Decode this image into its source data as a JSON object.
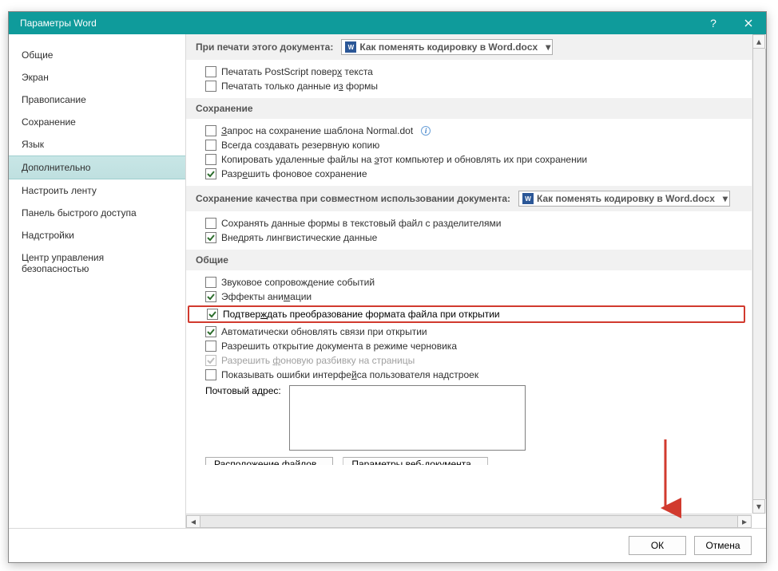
{
  "window": {
    "title": "Параметры Word",
    "help": "?",
    "close": "✕"
  },
  "sidebar": {
    "items": [
      {
        "label": "Общие"
      },
      {
        "label": "Экран"
      },
      {
        "label": "Правописание"
      },
      {
        "label": "Сохранение"
      },
      {
        "label": "Язык"
      },
      {
        "label": "Дополнительно",
        "selected": true
      },
      {
        "label": "Настроить ленту"
      },
      {
        "label": "Панель быстрого доступа"
      },
      {
        "label": "Надстройки"
      },
      {
        "label": "Центр управления безопасностью"
      }
    ]
  },
  "print": {
    "header": "При печати этого документа:",
    "doc": "Как поменять кодировку в Word.docx",
    "opt1": {
      "checked": false,
      "label_pre": "Печатать PostScript повер",
      "acc": "х",
      "label_post": " текста"
    },
    "opt2": {
      "checked": false,
      "label_pre": "Печатать только данные и",
      "acc": "з",
      "label_post": " формы"
    }
  },
  "save": {
    "header": "Сохранение",
    "opt1": {
      "checked": false,
      "label_pre": "",
      "acc": "З",
      "label_post": "апрос на сохранение шаблона Normal.dot"
    },
    "opt2": {
      "checked": false,
      "label": "Всегда создавать резервную копию"
    },
    "opt3": {
      "checked": false,
      "label_pre": "Копировать удаленные файлы на ",
      "acc": "э",
      "label_post": "тот компьютер и обновлять их при сохранении"
    },
    "opt4": {
      "checked": true,
      "label_pre": "Разр",
      "acc": "е",
      "label_post": "шить фоновое сохранение"
    }
  },
  "fidelity": {
    "header": "Сохранение качества при совместном использовании документа:",
    "doc": "Как поменять кодировку в Word.docx",
    "opt1": {
      "checked": false,
      "label": "Сохранять данные формы в текстовый файл с разделителями"
    },
    "opt2": {
      "checked": true,
      "label": "Внедрять лингвистические данные"
    }
  },
  "general": {
    "header": "Общие",
    "opt1": {
      "checked": false,
      "label": "Звуковое сопровождение событий"
    },
    "opt2": {
      "checked": true,
      "label_pre": "Эффекты ани",
      "acc": "м",
      "label_post": "ации"
    },
    "opt3": {
      "checked": true,
      "label_pre": "Подтвер",
      "acc": "ж",
      "label_post": "дать преобразование формата файла при открытии"
    },
    "opt4": {
      "checked": true,
      "label": "Автоматически обновлять связи при открытии"
    },
    "opt5": {
      "checked": false,
      "label": "Разрешить открытие документа в режиме черновика"
    },
    "opt6": {
      "checked": true,
      "disabled": true,
      "label_pre": "Разрешить ",
      "acc": "ф",
      "label_post": "оновую разбивку на страницы"
    },
    "opt7": {
      "checked": false,
      "label_pre": "Показывать ошибки интерфе",
      "acc": "й",
      "label_post": "са пользователя надстроек"
    },
    "address_label": "Почтовый адрес:",
    "btn_files": "Расположение файлов...",
    "btn_web": "Параметры веб-документа..."
  },
  "footer": {
    "ok": "ОК",
    "cancel": "Отмена"
  }
}
